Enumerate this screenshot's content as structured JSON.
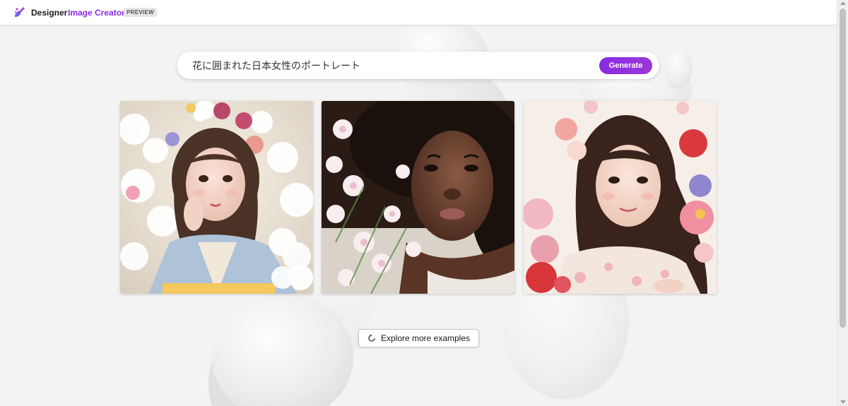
{
  "header": {
    "logo_icon": "designer-logo-icon",
    "brand": "Designer",
    "product": "Image Creator",
    "badge": "PREVIEW",
    "product_color": "#8a2be2"
  },
  "search": {
    "value": "花に囲まれた日本女性のポートレート",
    "generate_label": "Generate",
    "accent_color": "#8a2be2"
  },
  "images": [
    {
      "icon": "portrait-image"
    },
    {
      "icon": "portrait-image"
    },
    {
      "icon": "portrait-image"
    }
  ],
  "explore": {
    "label": "Explore more examples",
    "icon": "refresh-icon"
  }
}
